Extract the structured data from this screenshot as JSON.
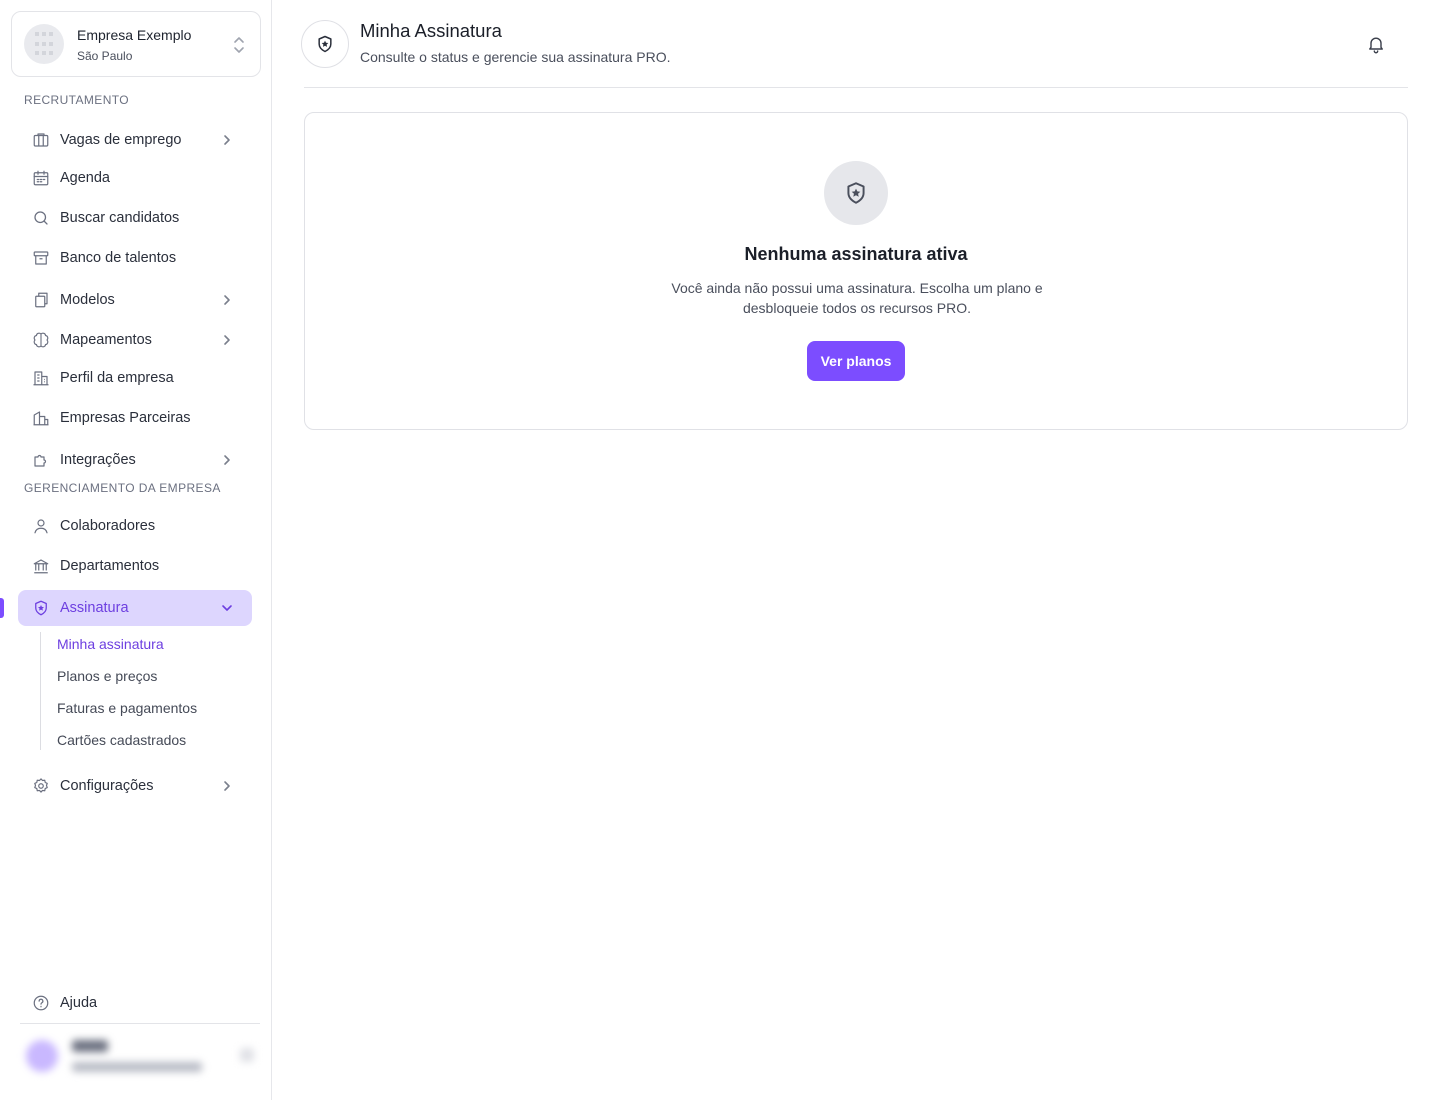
{
  "company": {
    "name": "Empresa Exemplo",
    "city": "São Paulo"
  },
  "sections": {
    "recruitment": "RECRUTAMENTO",
    "management": "GERENCIAMENTO DA EMPRESA"
  },
  "nav": {
    "vagas": "Vagas de emprego",
    "agenda": "Agenda",
    "buscar": "Buscar candidatos",
    "banco": "Banco de talentos",
    "modelos": "Modelos",
    "mapeamentos": "Mapeamentos",
    "perfil": "Perfil da empresa",
    "parceiras": "Empresas Parceiras",
    "integracoes": "Integrações",
    "colaboradores": "Colaboradores",
    "departamentos": "Departamentos",
    "assinatura": "Assinatura",
    "configuracoes": "Configurações",
    "ajuda": "Ajuda"
  },
  "subnav": {
    "minha": "Minha assinatura",
    "planos": "Planos e preços",
    "faturas": "Faturas e pagamentos",
    "cartoes": "Cartões cadastrados"
  },
  "header": {
    "title": "Minha Assinatura",
    "subtitle": "Consulte o status e gerencie sua assinatura PRO."
  },
  "empty_state": {
    "title": "Nenhuma assinatura ativa",
    "description": "Você ainda não possui uma assinatura. Escolha um plano e desbloqueie todos os recursos PRO.",
    "button": "Ver planos"
  },
  "colors": {
    "accent": "#7c4dff",
    "active_bg": "#ddd6fe",
    "active_text": "#6d3fe0"
  }
}
